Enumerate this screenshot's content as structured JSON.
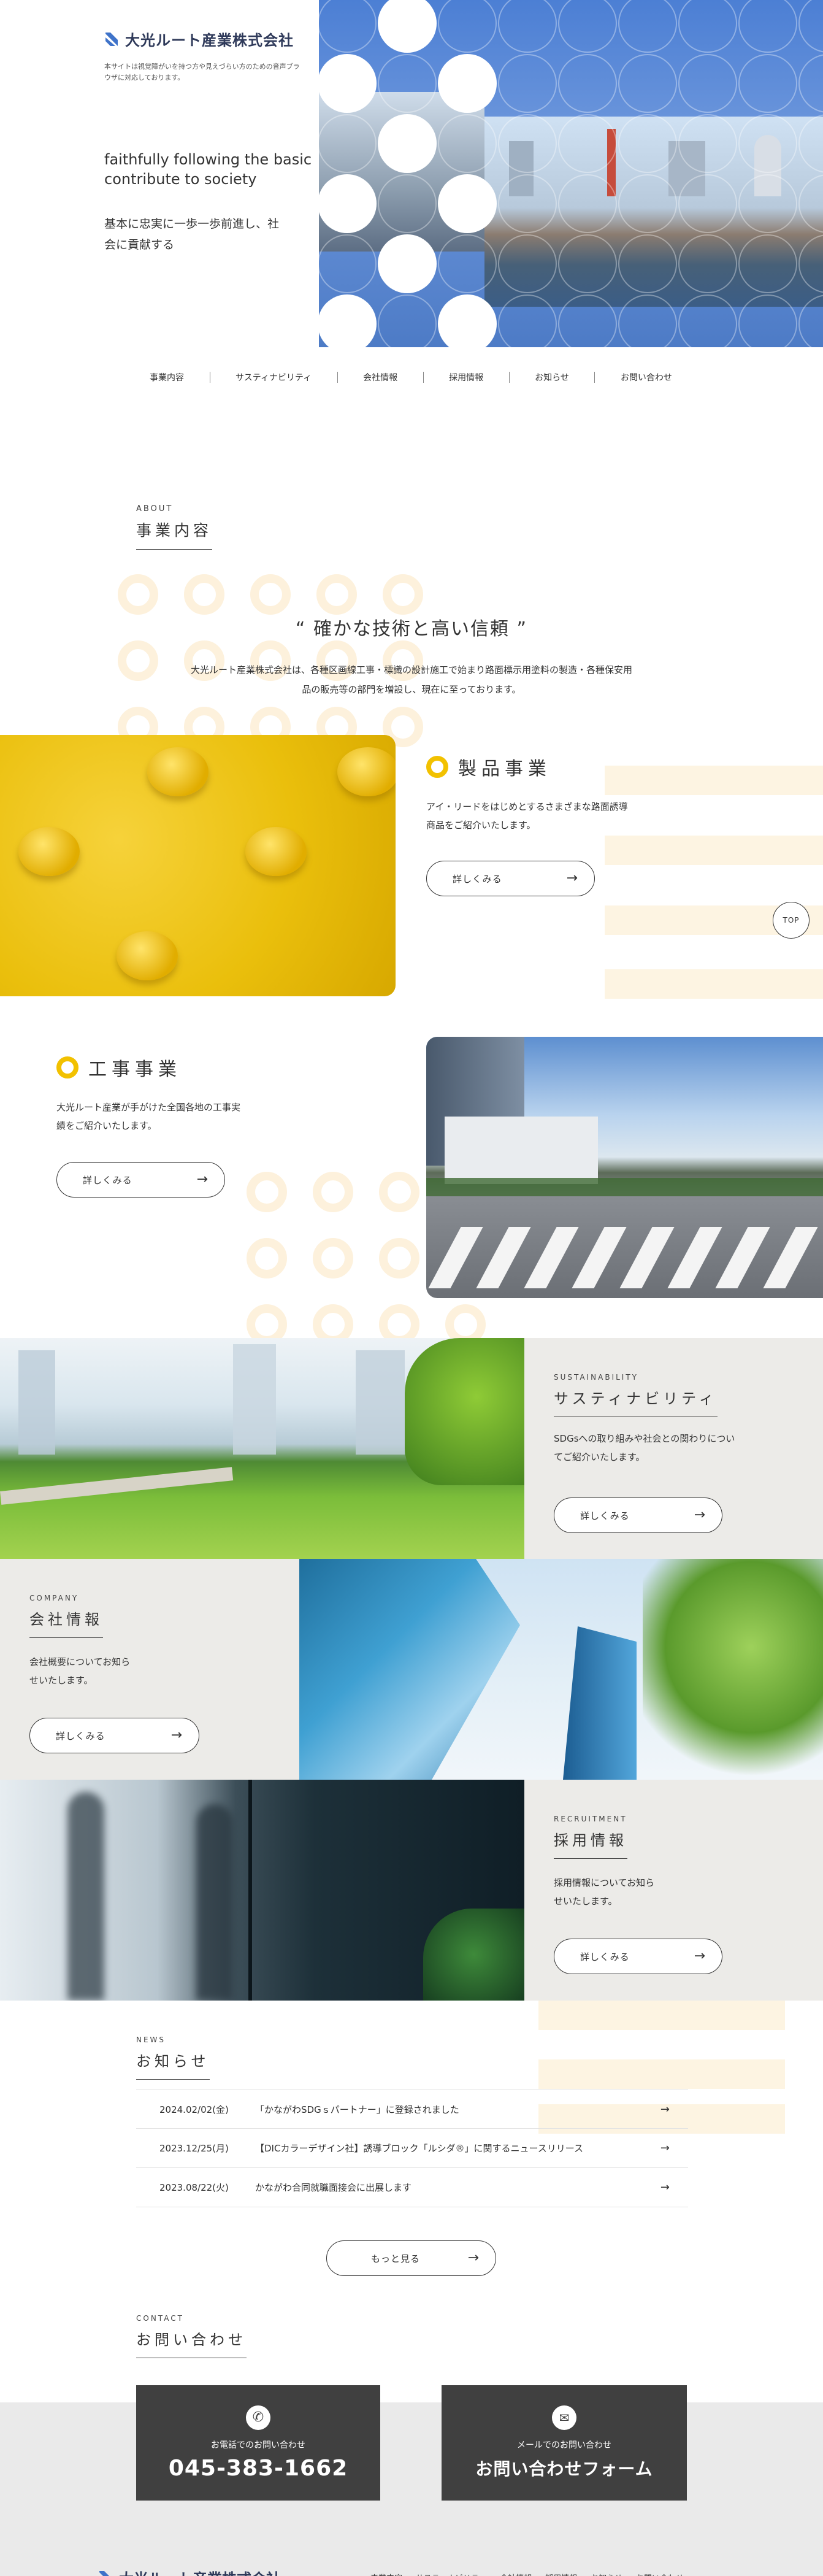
{
  "brand": {
    "name": "大光ルート産業株式会社",
    "accessibility_note": "本サイトは視覚障がいを持つ方や見えづらい方のための音声ブラウザに対応しております。"
  },
  "hero": {
    "tagline_en": "faithfully following the basic contribute to society",
    "tagline_ja": "基本に忠実に一歩一歩前進し、社会に貢献する"
  },
  "nav": {
    "items": [
      "事業内容",
      "サスティナビリティ",
      "会社情報",
      "採用情報",
      "お知らせ",
      "お問い合わせ"
    ]
  },
  "about": {
    "eyebrow": "ABOUT",
    "title": "事業内容",
    "quote": "“ 確かな技術と高い信頼 ”",
    "lead": "大光ルート産業株式会社は、各種区画線工事・標識の設計施工で始まり路面標示用塗料の製造・各種保安用品の販売等の部門を増設し、現在に至っております。"
  },
  "products": {
    "title": "製品事業",
    "desc": "アイ・リードをはじめとするさまざまな路面誘導商品をご紹介いたします。",
    "button": "詳しくみる"
  },
  "construction": {
    "title": "工事事業",
    "desc": "大光ルート産業が手がけた全国各地の工事実績をご紹介いたします。",
    "button": "詳しくみる"
  },
  "sustain": {
    "eyebrow": "SUSTAINABILITY",
    "title": "サスティナビリティ",
    "desc": "SDGsへの取り組みや社会との関わりについてご紹介いたします。",
    "button": "詳しくみる"
  },
  "company": {
    "eyebrow": "COMPANY",
    "title": "会社情報",
    "desc": "会社概要についてお知らせいたします。",
    "button": "詳しくみる"
  },
  "recruit": {
    "eyebrow": "RECRUITMENT",
    "title": "採用情報",
    "desc": "採用情報についてお知らせいたします。",
    "button": "詳しくみる"
  },
  "news": {
    "eyebrow": "NEWS",
    "title": "お知らせ",
    "items": [
      {
        "date": "2024.02/02(金)",
        "text": "「かながわSDGｓパートナー」に登録されました"
      },
      {
        "date": "2023.12/25(月)",
        "text": "【DICカラーデザイン社】誘導ブロック「ルシダ®」に関するニュースリリース"
      },
      {
        "date": "2023.08/22(火)",
        "text": "かながわ合同就職面接会に出展します"
      }
    ],
    "more": "もっと見る"
  },
  "contact": {
    "eyebrow": "CONTACT",
    "title": "お問い合わせ",
    "phone_label": "お電話でのお問い合わせ",
    "phone": "045-383-1662",
    "mail_label": "メールでのお問い合わせ",
    "mail": "お問い合わせフォーム"
  },
  "top": "TOP",
  "colors": {
    "accent": "#f2c100",
    "blue": "#3f73c9",
    "gray_bg": "#ecebe8",
    "dark": "#404040",
    "stripe": "#fdf4e2"
  }
}
